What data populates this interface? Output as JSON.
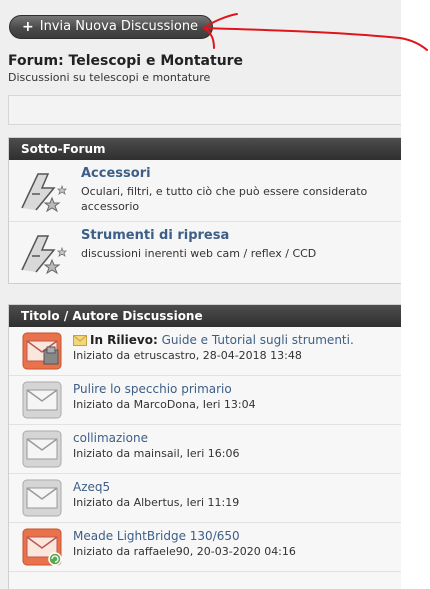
{
  "toolbar": {
    "new_thread_label": "Invia Nuova Discussione"
  },
  "forum": {
    "title": "Forum: Telescopi e Montature",
    "description": "Discussioni su telescopi e montature"
  },
  "subforums": {
    "header": "Sotto-Forum",
    "items": [
      {
        "name": "Accessori",
        "description": "Oculari, filtri, e tutto ciò che può essere considerato accessorio"
      },
      {
        "name": "Strumenti di ripresa",
        "description": "discussioni inerenti web cam / reflex / CCD"
      }
    ]
  },
  "threads": {
    "header": "Titolo / Autore Discussione",
    "items": [
      {
        "prefix": "In Rilievo:",
        "title": "Guide e Tutorial sugli strumenti.",
        "meta": "Iniziato da etruscastro, 28-04-2018 13:48"
      },
      {
        "prefix": "",
        "title": "Pulire lo specchio primario",
        "meta": "Iniziato da MarcoDona, Ieri 13:04"
      },
      {
        "prefix": "",
        "title": "collimazione",
        "meta": "Iniziato da mainsail, Ieri 16:06"
      },
      {
        "prefix": "",
        "title": "Azeq5",
        "meta": "Iniziato da Albertus, Ieri 11:19"
      },
      {
        "prefix": "",
        "title": "Meade LightBridge 130/650",
        "meta": "Iniziato da raffaele90, 20-03-2020 04:16"
      }
    ]
  },
  "colors": {
    "link": "#3d5e86",
    "header_bg": "#3a3a3a",
    "hot_icon": "#e8724a",
    "annotation": "#e0141b"
  },
  "icons": {
    "forum": "astronomy-forum-icon",
    "thread_read": "envelope-icon",
    "thread_hot": "hot-envelope-icon"
  }
}
